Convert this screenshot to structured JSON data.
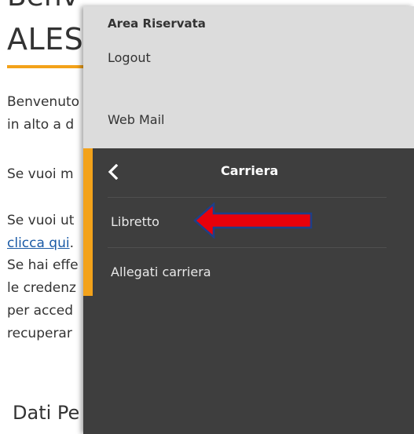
{
  "background": {
    "title_top": "Benv",
    "title": "ALES",
    "lines": [
      "Benvenuto",
      "in alto a d",
      "Se vuoi m",
      "Se vuoi ut",
      "clicca qui",
      ".",
      "Se hai effe",
      "le credenz",
      "per acced",
      "recuperar"
    ],
    "section": "Dati Pe"
  },
  "menu": {
    "area_title": "Area Riservata",
    "logout": "Logout",
    "webmail": "Web Mail",
    "carriera": {
      "title": "Carriera",
      "back_icon": "chevron-left-icon",
      "items": [
        {
          "label": "Libretto"
        },
        {
          "label": "Allegati carriera"
        }
      ]
    }
  },
  "annotation": {
    "arrow_color": "#e8000b",
    "arrow_border": "#1d3f8a"
  },
  "colors": {
    "accent": "#f3a21a",
    "panel_dark": "#3e3e3e",
    "panel_light": "#dcdcdc",
    "link": "#1a5aa6"
  }
}
